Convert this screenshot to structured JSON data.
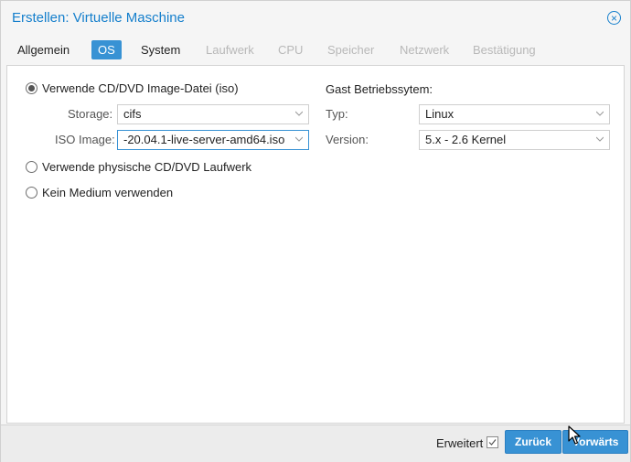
{
  "window": {
    "title": "Erstellen: Virtuelle Maschine",
    "close_icon": "close-circle-icon"
  },
  "tabs": [
    {
      "label": "Allgemein",
      "state": "normal"
    },
    {
      "label": "OS",
      "state": "active"
    },
    {
      "label": "System",
      "state": "normal"
    },
    {
      "label": "Laufwerk",
      "state": "disabled"
    },
    {
      "label": "CPU",
      "state": "disabled"
    },
    {
      "label": "Speicher",
      "state": "disabled"
    },
    {
      "label": "Netzwerk",
      "state": "disabled"
    },
    {
      "label": "Bestätigung",
      "state": "disabled"
    }
  ],
  "media": {
    "options": [
      {
        "label": "Verwende CD/DVD Image-Datei (iso)",
        "checked": true
      },
      {
        "label": "Verwende physische CD/DVD Laufwerk",
        "checked": false
      },
      {
        "label": "Kein Medium verwenden",
        "checked": false
      }
    ],
    "storage_label": "Storage:",
    "storage_value": "cifs",
    "iso_label": "ISO Image:",
    "iso_value": "-20.04.1-live-server-amd64.iso"
  },
  "guest": {
    "title": "Gast Betriebssytem:",
    "type_label": "Typ:",
    "type_value": "Linux",
    "version_label": "Version:",
    "version_value": "5.x - 2.6 Kernel"
  },
  "footer": {
    "advanced_label": "Erweitert",
    "advanced_checked": true,
    "back_label": "Zurück",
    "next_label": "Vorwärts"
  },
  "colors": {
    "accent": "#157fcc",
    "button": "#3892d4"
  }
}
